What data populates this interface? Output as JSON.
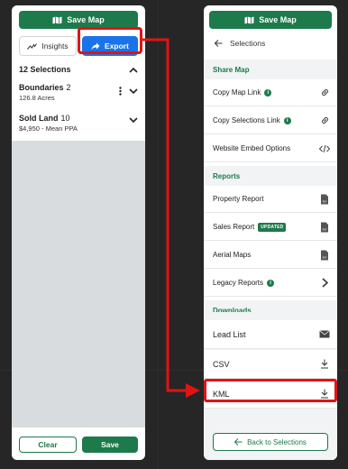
{
  "left_panel": {
    "save_map_label": "Save Map",
    "tabs": {
      "insights_label": "Insights",
      "export_label": "Export"
    },
    "selections_header": "12 Selections",
    "items": [
      {
        "title": "Boundaries",
        "count": "2",
        "subtitle": "126.8 Acres"
      },
      {
        "title": "Sold Land",
        "count": "10",
        "subtitle": "$4,950 - Mean PPA"
      }
    ],
    "clear_label": "Clear",
    "save_label": "Save"
  },
  "right_panel": {
    "save_map_label": "Save Map",
    "back_label": "Selections",
    "share_header": "Share Map",
    "share_rows": [
      {
        "label": "Copy Map Link",
        "icon": "link-icon"
      },
      {
        "label": "Copy Selections Link",
        "icon": "link-icon"
      },
      {
        "label": "Website Embed Options",
        "icon": "code-icon"
      }
    ],
    "reports_header": "Reports",
    "report_rows": [
      {
        "label": "Property Report",
        "icon": "pdf-icon"
      },
      {
        "label": "Sales Report",
        "badge": "UPDATED",
        "icon": "pdf-icon"
      },
      {
        "label": "Aerial Maps",
        "icon": "pdf-icon"
      },
      {
        "label": "Legacy Reports",
        "icon": "chevron-right-icon"
      }
    ],
    "downloads_header": "Downloads",
    "download_rows": [
      {
        "label": "Lead List",
        "icon": "mail-icon"
      },
      {
        "label": "CSV",
        "icon": "download-icon"
      },
      {
        "label": "KML",
        "icon": "download-icon"
      }
    ],
    "back_to_selections_label": "Back to Selections"
  },
  "colors": {
    "brand_green": "#1d7a4b",
    "export_blue": "#1a73e8",
    "highlight_red": "#e01414"
  }
}
